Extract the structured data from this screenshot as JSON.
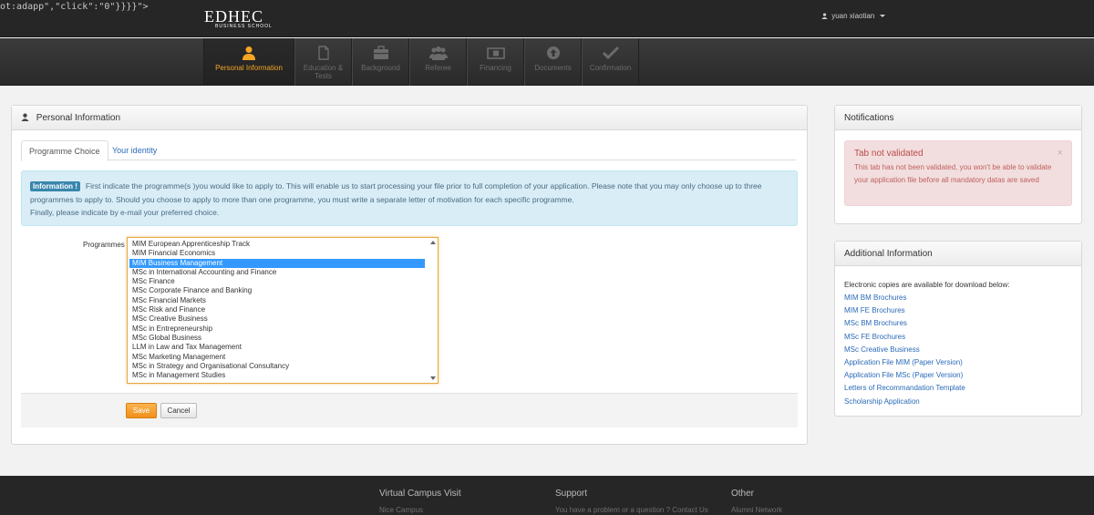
{
  "stray_text": "ot:adapp\",\"click\":\"0\"}}}}\">",
  "brand": {
    "logo_main": "EDHEC",
    "logo_sub": "BUSINESS SCHOOL"
  },
  "user": {
    "name": "yuan xiaotian"
  },
  "steps": [
    {
      "label": "Personal Information",
      "icon": "person-icon"
    },
    {
      "label": "Education & Tests",
      "icon": "document-icon"
    },
    {
      "label": "Background",
      "icon": "briefcase-icon"
    },
    {
      "label": "Referee",
      "icon": "group-icon"
    },
    {
      "label": "Financing",
      "icon": "money-icon"
    },
    {
      "label": "Documents",
      "icon": "upload-icon"
    },
    {
      "label": "Confirmation",
      "icon": "check-icon"
    }
  ],
  "main": {
    "title": "Personal Information",
    "tabs": {
      "programme": "Programme Choice",
      "identity": "Your identity"
    },
    "info": {
      "badge": "Information !",
      "text": "First indicate the programme(s )you would like to apply to. This will enable us to start processing your file prior to full completion of your application. Please note that you may only choose up to three programmes to apply to. Should you choose to apply to more than one programme, you must write a separate letter of motivation for each specific programme.",
      "text2": "Finally, please indicate by e-mail your preferred choice."
    },
    "programmes_label": "Programmes",
    "programmes": [
      "MIM European Apprenticeship Track",
      "MIM Financial Economics",
      "MIM Business Management",
      "MSc in International Accounting and Finance",
      "MSc Finance",
      "MSc Corporate Finance and Banking",
      "MSc Financial Markets",
      "MSc Risk and Finance",
      "MSc Creative Business",
      "MSc in Entrepreneurship",
      "MSc Global Business",
      "LLM in Law and Tax Management",
      "MSc Marketing Management",
      "MSc in Strategy and Organisational Consultancy",
      "MSc in Management Studies"
    ],
    "selected_programme": "MIM Business Management",
    "save_label": "Save",
    "cancel_label": "Cancel"
  },
  "notifications": {
    "title": "Notifications",
    "alert_title": "Tab not validated",
    "alert_text": "This tab has not been validated, you won't be able to validate your application file before all mandatory datas are saved",
    "close": "×"
  },
  "additional": {
    "title": "Additional Information",
    "intro": "Electronic copies are available for download below:",
    "links": [
      "MIM BM Brochures",
      "MIM FE Brochures",
      "MSc BM Brochures",
      "MSc FE Brochures",
      "MSc Creative Business",
      "Application File MIM (Paper Version)",
      "Application File MSc (Paper Version)",
      "Letters of Recommandation Template",
      "Scholarship Application"
    ]
  },
  "footer": {
    "col1": {
      "title": "Virtual Campus Visit",
      "item": "Nice Campus"
    },
    "col2": {
      "title": "Support",
      "item": "You have a problem or a question ? Contact Us"
    },
    "col3": {
      "title": "Other",
      "item": "Alumni Network"
    }
  },
  "colors": {
    "accent": "#f5a623",
    "link": "#2a6ab8",
    "info_bg": "#d9edf7",
    "alert_bg": "#f2dede"
  }
}
